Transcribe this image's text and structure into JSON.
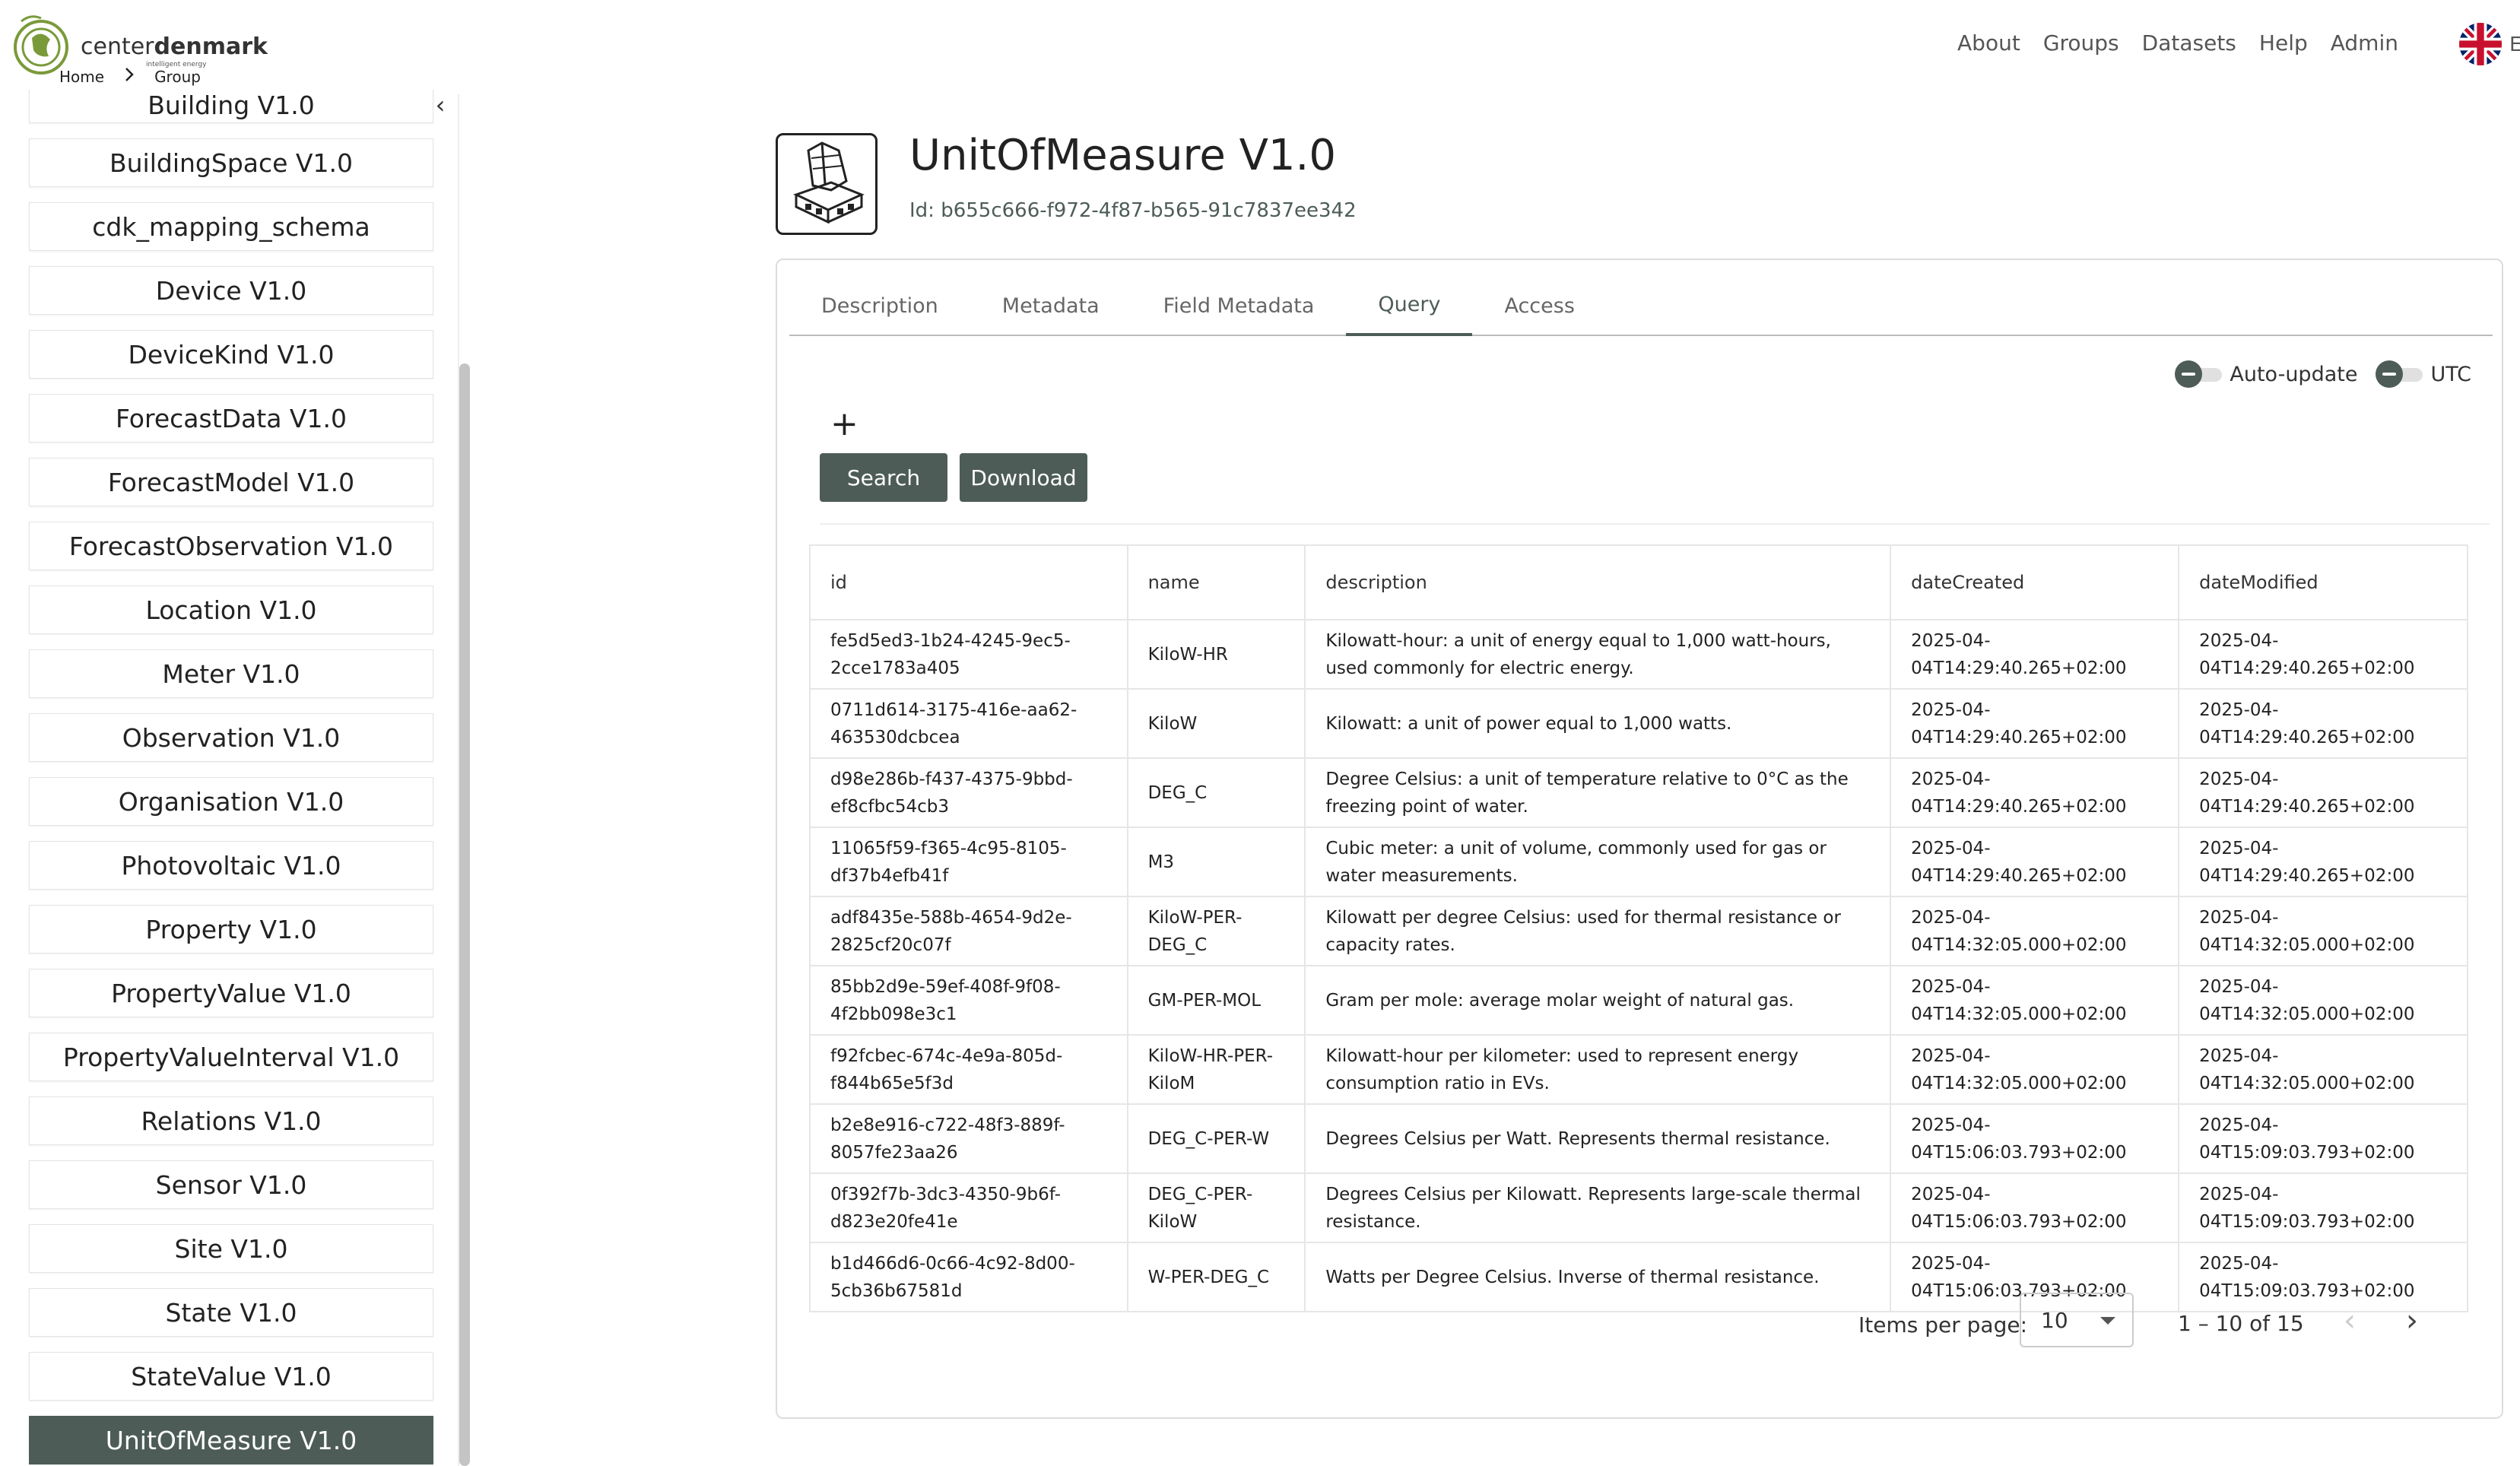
{
  "header": {
    "logo_text_light": "center",
    "logo_text_bold": "denmark",
    "logo_subtitle": "intelligent energy",
    "breadcrumb": [
      "Home",
      "Group"
    ],
    "nav": [
      "About",
      "Groups",
      "Datasets",
      "Help",
      "Admin"
    ],
    "language_letter": "E"
  },
  "sidebar": {
    "items": [
      "Building V1.0",
      "BuildingSpace V1.0",
      "cdk_mapping_schema",
      "Device V1.0",
      "DeviceKind V1.0",
      "ForecastData V1.0",
      "ForecastModel V1.0",
      "ForecastObservation V1.0",
      "Location V1.0",
      "Meter V1.0",
      "Observation V1.0",
      "Organisation V1.0",
      "Photovoltaic V1.0",
      "Property V1.0",
      "PropertyValue V1.0",
      "PropertyValueInterval V1.0",
      "Relations V1.0",
      "Sensor V1.0",
      "Site V1.0",
      "State V1.0",
      "StateValue V1.0",
      "UnitOfMeasure V1.0"
    ],
    "active_item": "UnitOfMeasure V1.0",
    "collapse_glyph": "‹"
  },
  "dataset": {
    "title": "UnitOfMeasure V1.0",
    "id_text": "Id: b655c666-f972-4f87-b565-91c7837ee342"
  },
  "tabs": [
    {
      "label": "Description",
      "active": false
    },
    {
      "label": "Metadata",
      "active": false
    },
    {
      "label": "Field Metadata",
      "active": false
    },
    {
      "label": "Query",
      "active": true
    },
    {
      "label": "Access",
      "active": false
    }
  ],
  "toggles": {
    "auto_update": "Auto-update",
    "utc": "UTC"
  },
  "query": {
    "add_glyph": "+",
    "search_label": "Search",
    "download_label": "Download"
  },
  "table": {
    "columns": [
      "id",
      "name",
      "description",
      "dateCreated",
      "dateModified"
    ],
    "rows": [
      {
        "id": "fe5d5ed3-1b24-4245-9ec5-2cce1783a405",
        "name": "KiloW-HR",
        "description": "Kilowatt-hour: a unit of energy equal to 1,000 watt-hours, used commonly for electric energy.",
        "dateCreated": "2025-04-04T14:29:40.265+02:00",
        "dateModified": "2025-04-04T14:29:40.265+02:00"
      },
      {
        "id": "0711d614-3175-416e-aa62-463530dcbcea",
        "name": "KiloW",
        "description": "Kilowatt: a unit of power equal to 1,000 watts.",
        "dateCreated": "2025-04-04T14:29:40.265+02:00",
        "dateModified": "2025-04-04T14:29:40.265+02:00"
      },
      {
        "id": "d98e286b-f437-4375-9bbd-ef8cfbc54cb3",
        "name": "DEG_C",
        "description": "Degree Celsius: a unit of temperature relative to 0°C as the freezing point of water.",
        "dateCreated": "2025-04-04T14:29:40.265+02:00",
        "dateModified": "2025-04-04T14:29:40.265+02:00"
      },
      {
        "id": "11065f59-f365-4c95-8105-df37b4efb41f",
        "name": "M3",
        "description": "Cubic meter: a unit of volume, commonly used for gas or water measurements.",
        "dateCreated": "2025-04-04T14:29:40.265+02:00",
        "dateModified": "2025-04-04T14:29:40.265+02:00"
      },
      {
        "id": "adf8435e-588b-4654-9d2e-2825cf20c07f",
        "name": "KiloW-PER-DEG_C",
        "description": "Kilowatt per degree Celsius: used for thermal resistance or capacity rates.",
        "dateCreated": "2025-04-04T14:32:05.000+02:00",
        "dateModified": "2025-04-04T14:32:05.000+02:00"
      },
      {
        "id": "85bb2d9e-59ef-408f-9f08-4f2bb098e3c1",
        "name": "GM-PER-MOL",
        "description": "Gram per mole: average molar weight of natural gas.",
        "dateCreated": "2025-04-04T14:32:05.000+02:00",
        "dateModified": "2025-04-04T14:32:05.000+02:00"
      },
      {
        "id": "f92fcbec-674c-4e9a-805d-f844b65e5f3d",
        "name": "KiloW-HR-PER-KiloM",
        "description": "Kilowatt-hour per kilometer: used to represent energy consumption ratio in EVs.",
        "dateCreated": "2025-04-04T14:32:05.000+02:00",
        "dateModified": "2025-04-04T14:32:05.000+02:00"
      },
      {
        "id": "b2e8e916-c722-48f3-889f-8057fe23aa26",
        "name": "DEG_C-PER-W",
        "description": "Degrees Celsius per Watt. Represents thermal resistance.",
        "dateCreated": "2025-04-04T15:06:03.793+02:00",
        "dateModified": "2025-04-04T15:09:03.793+02:00"
      },
      {
        "id": "0f392f7b-3dc3-4350-9b6f-d823e20fe41e",
        "name": "DEG_C-PER-KiloW",
        "description": "Degrees Celsius per Kilowatt. Represents large-scale thermal resistance.",
        "dateCreated": "2025-04-04T15:06:03.793+02:00",
        "dateModified": "2025-04-04T15:09:03.793+02:00"
      },
      {
        "id": "b1d466d6-0c66-4c92-8d00-5cb36b67581d",
        "name": "W-PER-DEG_C",
        "description": "Watts per Degree Celsius. Inverse of thermal resistance.",
        "dateCreated": "2025-04-04T15:06:03.793+02:00",
        "dateModified": "2025-04-04T15:09:03.793+02:00"
      }
    ]
  },
  "paginator": {
    "items_per_page_label": "Items per page:",
    "items_per_page_value": "10",
    "range_label": "1 – 10 of 15",
    "prev_glyph": "‹",
    "next_glyph": "›"
  },
  "colors": {
    "accent": "#4d5c56",
    "logo_green": "#7a9a3a"
  },
  "icons": {
    "dataset_icon": "building-dataset-icon",
    "flag": "uk-flag-icon"
  }
}
